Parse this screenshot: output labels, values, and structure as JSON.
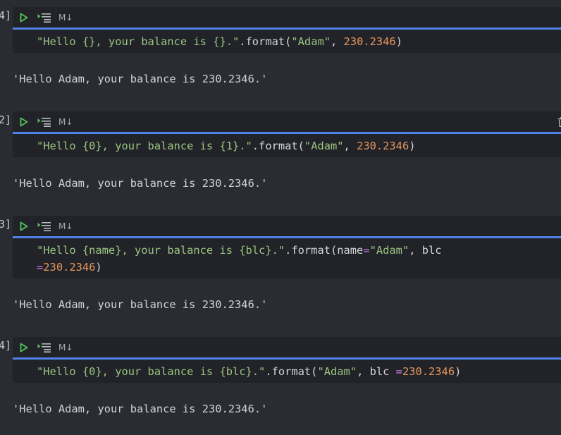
{
  "toolbar": {
    "md_label": "M↓"
  },
  "cells": [
    {
      "prompt": "4]",
      "code_line1": {
        "str": "\"Hello {}, your balance is {}.\"",
        "dot_format": ".format(",
        "arg1": "\"Adam\"",
        "sep": ", ",
        "num": "230.2346",
        "close": ")"
      },
      "output": "'Hello Adam, your balance is 230.2346.'"
    },
    {
      "prompt": "2]",
      "code_line1": {
        "str": "\"Hello {0}, your balance is {1}.\"",
        "dot_format": ".format(",
        "arg1": "\"Adam\"",
        "sep": ", ",
        "num": "230.2346",
        "close": ")"
      },
      "output": "'Hello Adam, your balance is 230.2346.'"
    },
    {
      "prompt": "3]",
      "code_line1": {
        "str": "\"Hello {name}, your balance is {blc}.\"",
        "dot_format": ".format(name",
        "eq": "=",
        "arg1": "\"Adam\"",
        "sep": ", blc"
      },
      "code_line2": {
        "eq": "=",
        "num": "230.2346",
        "close": ")"
      },
      "output": "'Hello Adam, your balance is 230.2346.'"
    },
    {
      "prompt": "4]",
      "code_line1": {
        "str": "\"Hello {0}, your balance is {blc}.\"",
        "dot_format": ".format(",
        "arg1": "\"Adam\"",
        "sep": ", blc ",
        "eq": "=",
        "num": "230.2346",
        "close": ")"
      },
      "output": "'Hello Adam, your balance is 230.2346.'"
    }
  ],
  "colors": {
    "background": "#292c33",
    "cell_background": "#212329",
    "active_border": "#4f82e8",
    "run_icon": "#52c45a",
    "string": "#9bc57f",
    "number": "#e5965d",
    "operator": "#c678dd",
    "text": "#d4d6da"
  },
  "icons": {
    "run": "play-icon",
    "run_by_line": "run-by-line-icon",
    "delete": "trash-icon"
  }
}
